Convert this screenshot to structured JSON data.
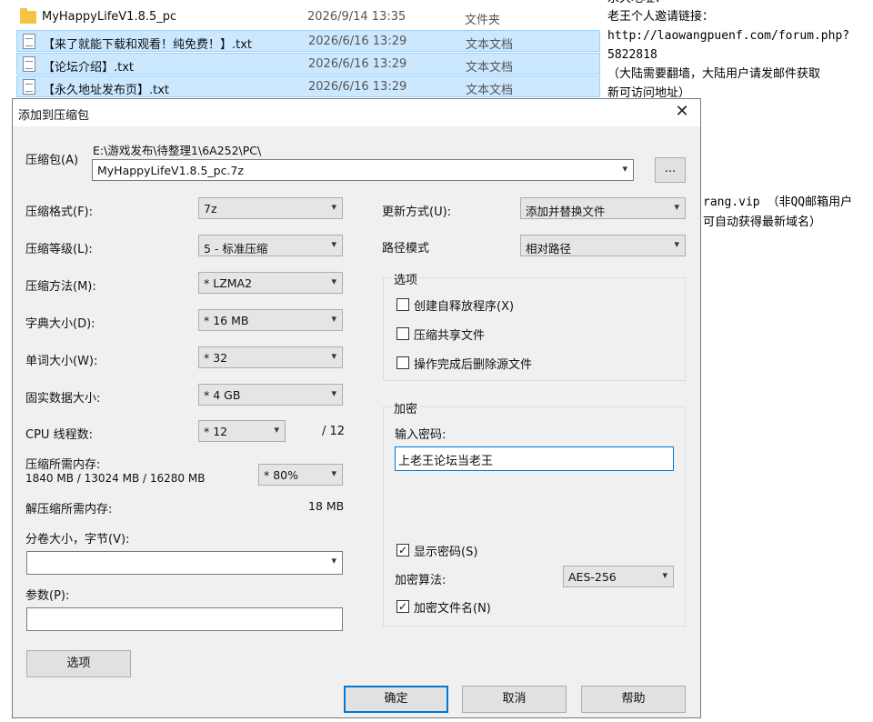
{
  "explorer": {
    "rows": [
      {
        "name": "MyHappyLifeV1.8.5_pc",
        "date": "2026/9/14 13:35",
        "type": "文件夹",
        "icon": "folder-icon"
      },
      {
        "name": "【来了就能下载和观看！纯免费！】.txt",
        "date": "2026/6/16 13:29",
        "type": "文本文档",
        "icon": "text-file-icon"
      },
      {
        "name": "【论坛介绍】.txt",
        "date": "2026/6/16 13:29",
        "type": "文本文档",
        "icon": "text-file-icon"
      },
      {
        "name": "【永久地址发布页】.txt",
        "date": "2026/6/16 13:29",
        "type": "文本文档",
        "icon": "text-file-icon"
      }
    ]
  },
  "notes": {
    "lines": [
      "永久地址：",
      "老王个人邀请链接：",
      "http://laowangpuenf.com/forum.php?",
      "5822818",
      "（大陆需要翻墙，大陆用户请发邮件获取",
      "新可访问地址）",
      "rang.vip （非QQ邮箱用户",
      "可自动获得最新域名）"
    ]
  },
  "dialog": {
    "title": "添加到压缩包",
    "archive_label": "压缩包(A)",
    "archive_path": "E:\\游戏发布\\待整理1\\6A252\\PC\\",
    "archive_name": "MyHappyLifeV1.8.5_pc.7z",
    "browse_label": "...",
    "left": [
      {
        "label": "压缩格式(F):",
        "value": "7z"
      },
      {
        "label": "压缩等级(L):",
        "value": "5 - 标准压缩"
      },
      {
        "label": "压缩方法(M):",
        "value": "* LZMA2"
      },
      {
        "label": "字典大小(D):",
        "value": "* 16 MB"
      },
      {
        "label": "单词大小(W):",
        "value": "* 32"
      },
      {
        "label": "固实数据大小:",
        "value": "* 4 GB"
      }
    ],
    "cpu_label": "CPU 线程数:",
    "cpu_value": "* 12",
    "cpu_max": "/ 12",
    "mem_label": "压缩所需内存:",
    "mem_detail": "1840 MB / 13024 MB / 16280 MB",
    "mem_value": "* 80%",
    "unmem_label": "解压缩所需内存:",
    "unmem_value": "18 MB",
    "split_label": "分卷大小，字节(V):",
    "split_value": "",
    "params_label": "参数(P):",
    "params_value": "",
    "options_button": "选项",
    "update_label": "更新方式(U):",
    "update_value": "添加并替换文件",
    "path_label": "路径模式",
    "path_value": "相对路径",
    "options_group": "选项",
    "opt_sfx": "创建自释放程序(X)",
    "opt_shared": "压缩共享文件",
    "opt_delete": "操作完成后删除源文件",
    "enc_group": "加密",
    "pwd_label": "输入密码:",
    "pwd_value": "上老王论坛当老王",
    "show_pwd": "显示密码(S)",
    "enc_method_label": "加密算法:",
    "enc_method_value": "AES-256",
    "enc_names": "加密文件名(N)",
    "ok": "确定",
    "cancel": "取消",
    "help": "帮助"
  }
}
